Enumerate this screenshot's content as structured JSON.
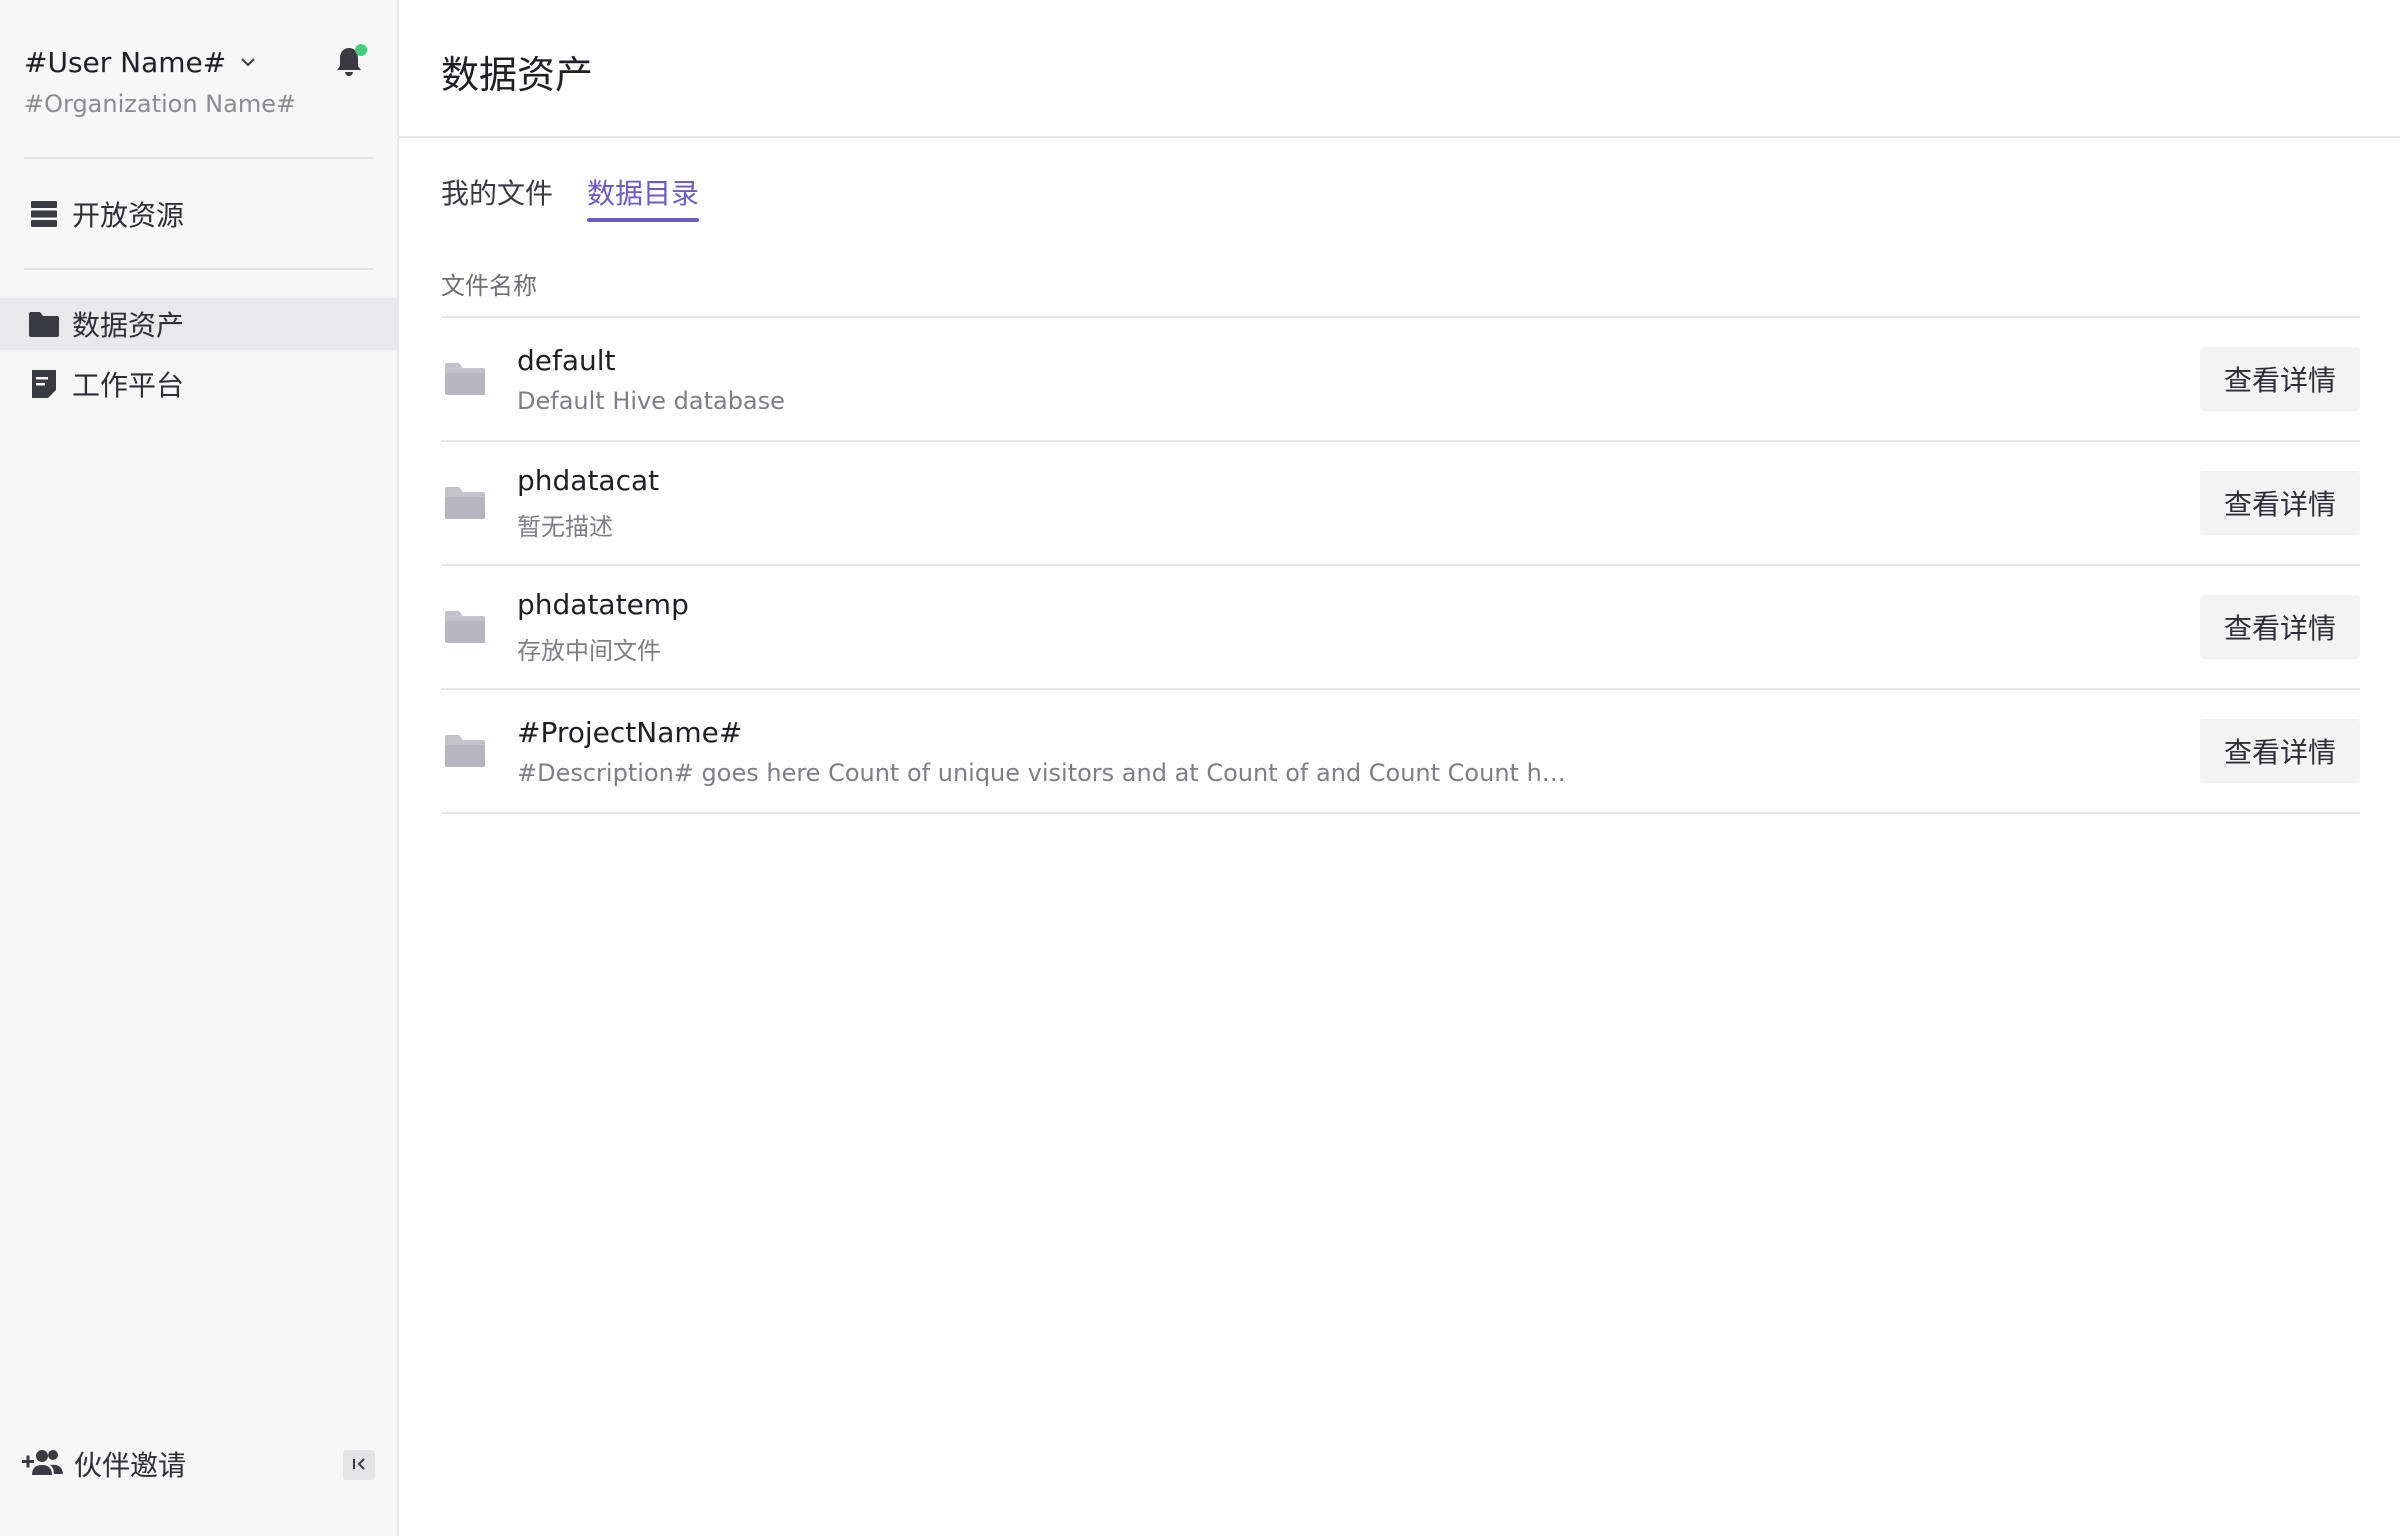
{
  "sidebar": {
    "user_name": "#User Name#",
    "org_name": "#Organization Name#",
    "nav": {
      "open_resources": "开放资源",
      "data_assets": "数据资产",
      "workbench": "工作平台"
    },
    "invite_label": "伙伴邀请",
    "notification_dot_color": "#3fcf7b"
  },
  "header": {
    "title": "数据资产"
  },
  "tabs": {
    "my_files": "我的文件",
    "data_catalog": "数据目录",
    "active": "数据目录",
    "accent_color": "#6e59c9"
  },
  "table": {
    "column_header": "文件名称",
    "detail_button_label": "查看详情",
    "rows": [
      {
        "name": "default",
        "description": "Default Hive database"
      },
      {
        "name": "phdatacat",
        "description": "暂无描述"
      },
      {
        "name": "phdatatemp",
        "description": "存放中间文件"
      },
      {
        "name": "#ProjectName#",
        "description": "#Description# goes here Count of unique visitors and at Count of and Count Count heel ..."
      }
    ]
  }
}
